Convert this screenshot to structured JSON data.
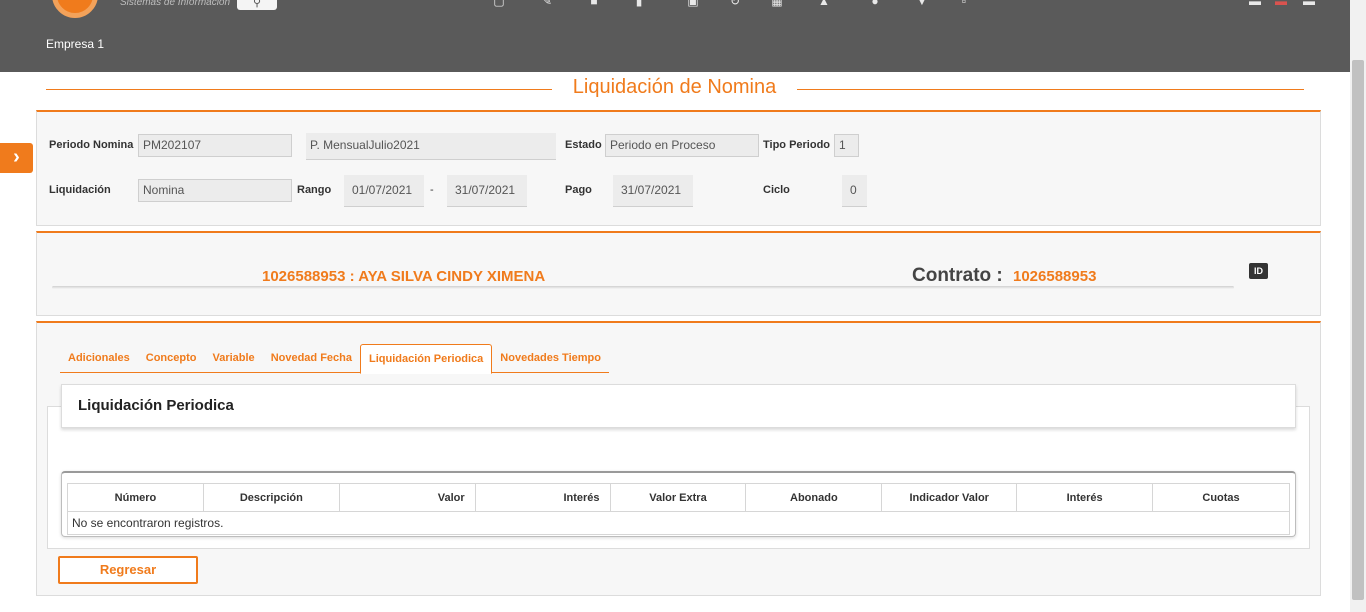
{
  "header": {
    "logo_subtitle": "Sistemas de Información",
    "company": "Empresa 1",
    "icons": [
      "document-icon",
      "edit-icon",
      "users-icon",
      "chart-icon",
      "box-icon",
      "refresh-icon",
      "calendar-icon",
      "tools-icon",
      "globe-icon",
      "location-icon",
      "mail-icon"
    ]
  },
  "page": {
    "title": "Liquidación de Nomina"
  },
  "periodo": {
    "periodo_label": "Periodo Nomina",
    "periodo_value": "PM202107",
    "periodo_desc": "P. MensualJulio2021",
    "estado_label": "Estado",
    "estado_value": "Periodo en Proceso",
    "tipo_label": "Tipo Periodo",
    "tipo_value": "1",
    "liquidacion_label": "Liquidación",
    "liquidacion_value": "Nomina",
    "rango_label": "Rango",
    "rango_desde": "01/07/2021",
    "rango_sep": "-",
    "rango_hasta": "31/07/2021",
    "pago_label": "Pago",
    "pago_value": "31/07/2021",
    "ciclo_label": "Ciclo",
    "ciclo_value": "0"
  },
  "empleado": {
    "nombre": "1026588953 : AYA SILVA CINDY XIMENA",
    "contrato_label": "Contrato :",
    "contrato_value": "1026588953"
  },
  "tabs": [
    {
      "label": "Adicionales",
      "active": false
    },
    {
      "label": "Concepto",
      "active": false
    },
    {
      "label": "Variable",
      "active": false
    },
    {
      "label": "Novedad Fecha",
      "active": false
    },
    {
      "label": "Liquidación Periodica",
      "active": true
    },
    {
      "label": "Novedades Tiempo",
      "active": false
    }
  ],
  "section": {
    "title": "Liquidación Periodica",
    "columns": [
      "Número",
      "Descripción",
      "Valor",
      "Interés",
      "Valor Extra",
      "Abonado",
      "Indicador Valor",
      "Interés",
      "Cuotas"
    ],
    "empty_message": "No se encontraron registros."
  },
  "actions": {
    "back_label": "Regresar"
  }
}
